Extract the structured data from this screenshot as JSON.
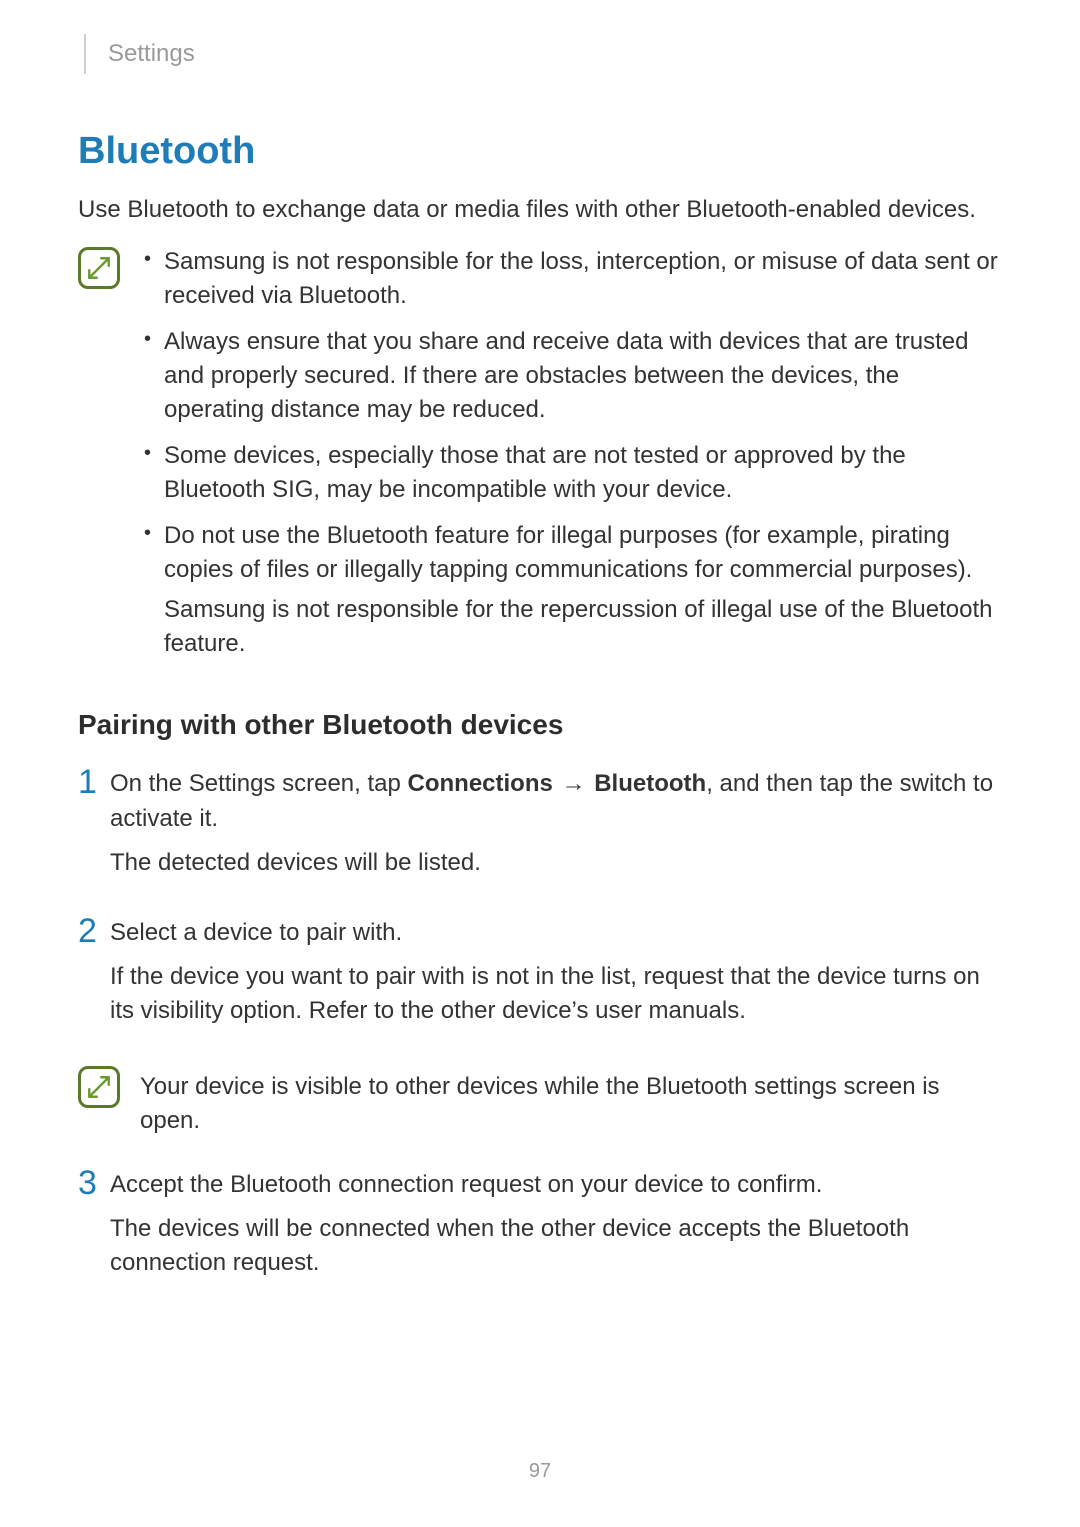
{
  "header": {
    "label": "Settings"
  },
  "title": "Bluetooth",
  "intro": "Use Bluetooth to exchange data or media files with other Bluetooth-enabled devices.",
  "notes": {
    "items": [
      "Samsung is not responsible for the loss, interception, or misuse of data sent or received via Bluetooth.",
      "Always ensure that you share and receive data with devices that are trusted and properly secured. If there are obstacles between the devices, the operating distance may be reduced.",
      "Some devices, especially those that are not tested or approved by the Bluetooth SIG, may be incompatible with your device.",
      "Do not use the Bluetooth feature for illegal purposes (for example, pirating copies of files or illegally tapping communications for commercial purposes).",
      "Samsung is not responsible for the repercussion of illegal use of the Bluetooth feature."
    ]
  },
  "section_heading": "Pairing with other Bluetooth devices",
  "steps": {
    "one": {
      "num": "1",
      "prefix": "On the Settings screen, tap ",
      "bold1": "Connections",
      "arrow": "→",
      "bold2": "Bluetooth",
      "suffix": ", and then tap the switch to activate it.",
      "para2": "The detected devices will be listed."
    },
    "two": {
      "num": "2",
      "para1": "Select a device to pair with.",
      "para2": "If the device you want to pair with is not in the list, request that the device turns on its visibility option. Refer to the other device’s user manuals."
    },
    "note_after_two": "Your device is visible to other devices while the Bluetooth settings screen is open.",
    "three": {
      "num": "3",
      "para1": "Accept the Bluetooth connection request on your device to confirm.",
      "para2": "The devices will be connected when the other device accepts the Bluetooth connection request."
    }
  },
  "page_number": "97"
}
